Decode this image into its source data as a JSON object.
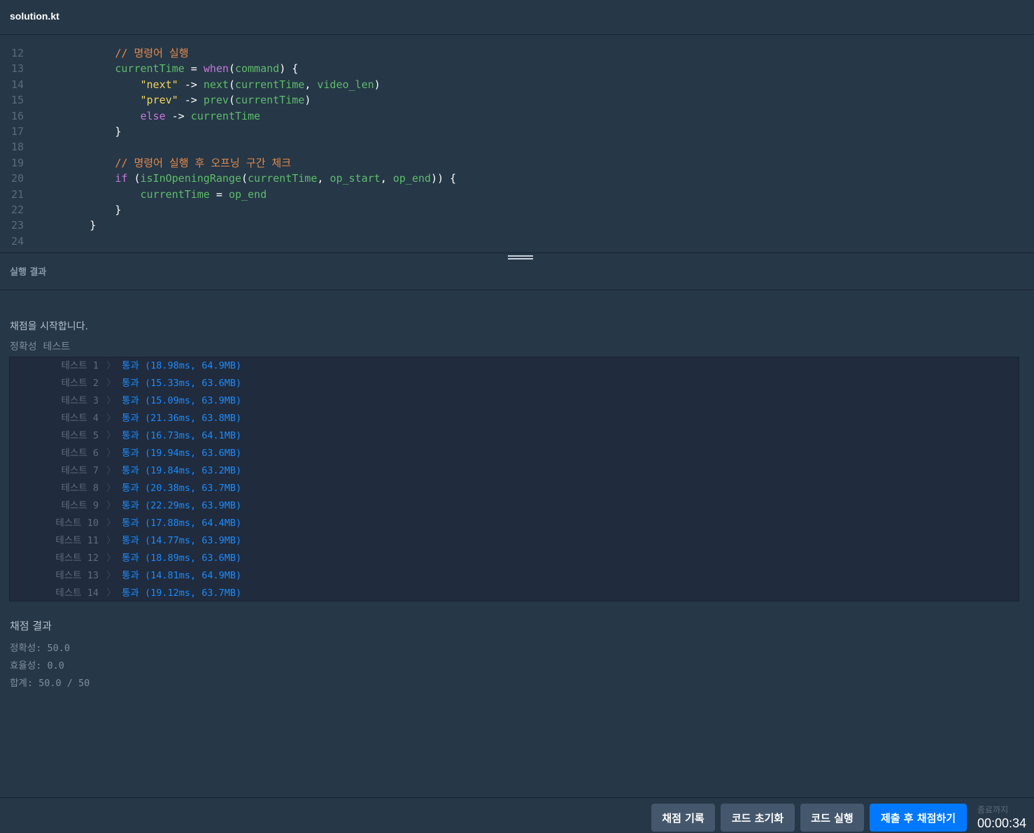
{
  "file_title": "solution.kt",
  "code": {
    "lines": [
      {
        "no": "12",
        "indent": "            ",
        "tokens": [
          {
            "t": "// 명령어 실행",
            "c": "comment"
          }
        ]
      },
      {
        "no": "13",
        "indent": "            ",
        "tokens": [
          {
            "t": "currentTime",
            "c": "var"
          },
          {
            "t": " = ",
            "c": "plain"
          },
          {
            "t": "when",
            "c": "kw"
          },
          {
            "t": "(",
            "c": "plain"
          },
          {
            "t": "command",
            "c": "var"
          },
          {
            "t": ") {",
            "c": "plain"
          }
        ]
      },
      {
        "no": "14",
        "indent": "                ",
        "tokens": [
          {
            "t": "\"next\"",
            "c": "str"
          },
          {
            "t": " -> ",
            "c": "plain"
          },
          {
            "t": "next",
            "c": "fn"
          },
          {
            "t": "(",
            "c": "plain"
          },
          {
            "t": "currentTime",
            "c": "var"
          },
          {
            "t": ", ",
            "c": "plain"
          },
          {
            "t": "video_len",
            "c": "var"
          },
          {
            "t": ")",
            "c": "plain"
          }
        ]
      },
      {
        "no": "15",
        "indent": "                ",
        "tokens": [
          {
            "t": "\"prev\"",
            "c": "str"
          },
          {
            "t": " -> ",
            "c": "plain"
          },
          {
            "t": "prev",
            "c": "fn"
          },
          {
            "t": "(",
            "c": "plain"
          },
          {
            "t": "currentTime",
            "c": "var"
          },
          {
            "t": ")",
            "c": "plain"
          }
        ]
      },
      {
        "no": "16",
        "indent": "                ",
        "tokens": [
          {
            "t": "else",
            "c": "kw"
          },
          {
            "t": " -> ",
            "c": "plain"
          },
          {
            "t": "currentTime",
            "c": "var"
          }
        ]
      },
      {
        "no": "17",
        "indent": "            ",
        "tokens": [
          {
            "t": "}",
            "c": "plain"
          }
        ]
      },
      {
        "no": "18",
        "indent": "",
        "tokens": []
      },
      {
        "no": "19",
        "indent": "            ",
        "tokens": [
          {
            "t": "// 명령어 실행 후 오프닝 구간 체크",
            "c": "comment"
          }
        ]
      },
      {
        "no": "20",
        "indent": "            ",
        "tokens": [
          {
            "t": "if",
            "c": "kw"
          },
          {
            "t": " (",
            "c": "plain"
          },
          {
            "t": "isInOpeningRange",
            "c": "fn"
          },
          {
            "t": "(",
            "c": "plain"
          },
          {
            "t": "currentTime",
            "c": "var"
          },
          {
            "t": ", ",
            "c": "plain"
          },
          {
            "t": "op_start",
            "c": "var"
          },
          {
            "t": ", ",
            "c": "plain"
          },
          {
            "t": "op_end",
            "c": "var"
          },
          {
            "t": ")) {",
            "c": "plain"
          }
        ]
      },
      {
        "no": "21",
        "indent": "                ",
        "tokens": [
          {
            "t": "currentTime",
            "c": "var"
          },
          {
            "t": " = ",
            "c": "plain"
          },
          {
            "t": "op_end",
            "c": "var"
          }
        ]
      },
      {
        "no": "22",
        "indent": "            ",
        "tokens": [
          {
            "t": "}",
            "c": "plain"
          }
        ]
      },
      {
        "no": "23",
        "indent": "        ",
        "tokens": [
          {
            "t": "}",
            "c": "plain"
          }
        ]
      },
      {
        "no": "24",
        "indent": "",
        "tokens": []
      }
    ]
  },
  "result_panel": {
    "title": "실행 결과",
    "start_message": "채점을 시작합니다.",
    "section_label": "정확성  테스트",
    "tests": [
      {
        "name": "테스트 1",
        "result": "통과 (18.98ms, 64.9MB)"
      },
      {
        "name": "테스트 2",
        "result": "통과 (15.33ms, 63.6MB)"
      },
      {
        "name": "테스트 3",
        "result": "통과 (15.09ms, 63.9MB)"
      },
      {
        "name": "테스트 4",
        "result": "통과 (21.36ms, 63.8MB)"
      },
      {
        "name": "테스트 5",
        "result": "통과 (16.73ms, 64.1MB)"
      },
      {
        "name": "테스트 6",
        "result": "통과 (19.94ms, 63.6MB)"
      },
      {
        "name": "테스트 7",
        "result": "통과 (19.84ms, 63.2MB)"
      },
      {
        "name": "테스트 8",
        "result": "통과 (20.38ms, 63.7MB)"
      },
      {
        "name": "테스트 9",
        "result": "통과 (22.29ms, 63.9MB)"
      },
      {
        "name": "테스트 10",
        "result": "통과 (17.88ms, 64.4MB)"
      },
      {
        "name": "테스트 11",
        "result": "통과 (14.77ms, 63.9MB)"
      },
      {
        "name": "테스트 12",
        "result": "통과 (18.89ms, 63.6MB)"
      },
      {
        "name": "테스트 13",
        "result": "통과 (14.81ms, 64.9MB)"
      },
      {
        "name": "테스트 14",
        "result": "통과 (19.12ms, 63.7MB)"
      }
    ],
    "test_separator": "〉",
    "summary": {
      "title": "채점 결과",
      "accuracy": "정확성: 50.0",
      "efficiency": "효율성: 0.0",
      "total": "합계: 50.0 / 50"
    }
  },
  "footer": {
    "history_button": "채점 기록",
    "reset_button": "코드 초기화",
    "run_button": "코드 실행",
    "submit_button": "제출 후 채점하기",
    "timer_label": "종료까지",
    "timer_value": "00:00:34"
  },
  "colors": {
    "background": "#263747",
    "accent": "#0078ff",
    "pass": "#1b8cff"
  }
}
